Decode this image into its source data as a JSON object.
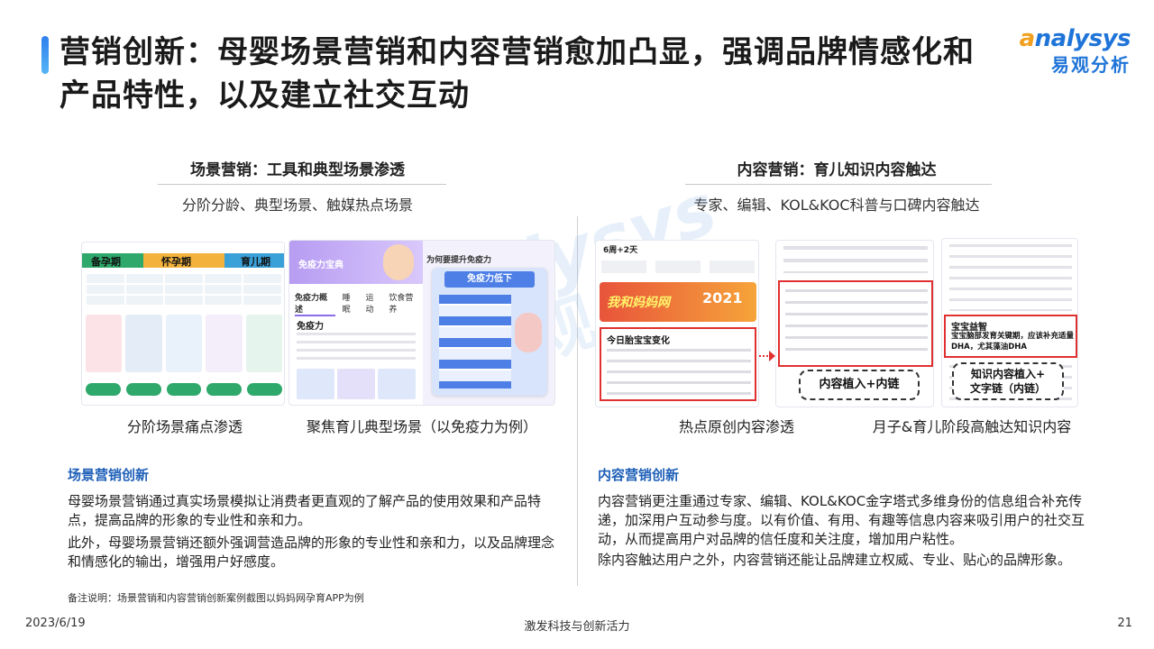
{
  "header": {
    "title": "营销创新：母婴场景营销和内容营销愈加凸显，强调品牌情感化和产品特性，以及建立社交互动",
    "logo_en_a": "a",
    "logo_en_rest": "nalysys",
    "logo_cn": "易观分析"
  },
  "left": {
    "heading": "场景营销：工具和典型场景渗透",
    "subheading": "分阶分龄、典型场景、触媒热点场景",
    "caption1": "分阶场景痛点渗透",
    "caption2": "聚焦育儿典型场景（以免疫力为例）",
    "panel1": {
      "stages": [
        "备孕期",
        "怀孕期",
        "育儿期"
      ]
    },
    "panel2": {
      "app_title": "免疫力宝典",
      "tabs": [
        "免疫力概述",
        "睡眠",
        "运动",
        "饮食营养"
      ],
      "section": "免疫力",
      "question": "为何要提升免疫力",
      "card_title": "免疫力低下"
    },
    "innovation_title": "场景营销创新",
    "para1": "母婴场景营销通过真实场景模拟让消费者更直观的了解产品的使用效果和产品特点，提高品牌的形象的专业性和亲和力。",
    "para2": "此外，母婴场景营销还额外强调营造品牌的形象的专业性和亲和力，以及品牌理念和情感化的输出，增强用户好感度。"
  },
  "right": {
    "heading": "内容营销：育儿知识内容触达",
    "subheading": "专家、编辑、KOL&KOC科普与口碑内容触达",
    "caption1": "热点原创内容渗透",
    "caption2": "月子&育儿阶段高触达知识内容",
    "panel3": {
      "week": "6周+2天",
      "banner": "我和妈妈网",
      "year": "2021",
      "change_title": "今日胎宝宝变化",
      "callout": "内容植入+内链"
    },
    "panel4": {
      "red_title": "宝宝益智",
      "red_text": "宝宝脑部发育关键期，应该补充适量DHA，尤其藻油DHA",
      "callout_line1": "知识内容植入+",
      "callout_line2": "文字链（内链）"
    },
    "innovation_title": "内容营销创新",
    "para1": "内容营销更注重通过专家、编辑、KOL&KOC金字塔式多维身份的信息组合补充传递，加深用户互动参与度。以有价值、有用、有趣等信息内容来吸引用户的社交互动，从而提高用户对品牌的信任度和关注度，增加用户粘性。",
    "para2": "除内容触达用户之外，内容营销还能让品牌建立权威、专业、贴心的品牌形象。"
  },
  "note": "备注说明：场景营销和内容营销创新案例截图以妈妈网孕育APP为例",
  "footer": {
    "date": "2023/6/19",
    "center": "激发科技与创新活力",
    "page": "21"
  },
  "colors": {
    "accent": "#1e74d8",
    "highlight": "#e03030",
    "title": "#1a1a1a"
  }
}
